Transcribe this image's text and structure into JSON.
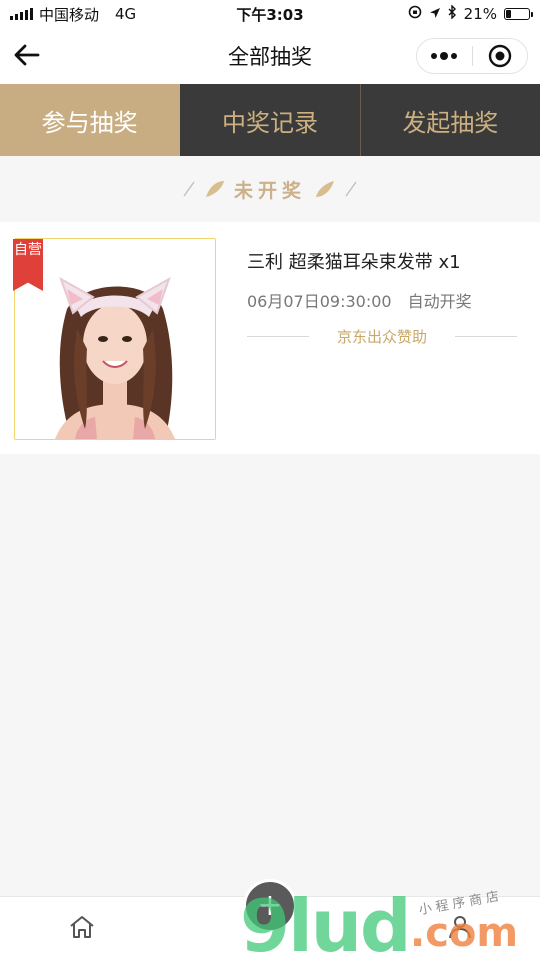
{
  "status_bar": {
    "carrier": "中国移动",
    "network": "4G",
    "time": "下午3:03",
    "battery_percent": "21%",
    "battery_level": 0.21
  },
  "nav": {
    "title": "全部抽奖"
  },
  "tabs": [
    {
      "label": "参与抽奖",
      "active": true
    },
    {
      "label": "中奖记录",
      "active": false
    },
    {
      "label": "发起抽奖",
      "active": false
    }
  ],
  "section": {
    "title": "未开奖"
  },
  "prize": {
    "badge": "自营",
    "name": "三利 超柔猫耳朵束发带 x1",
    "draw_time": "06月07日09:30:00",
    "draw_mode": "自动开奖",
    "sponsor": "京东出众赞助"
  },
  "watermark": {
    "brand": "9lud",
    "domain": ".com",
    "tagline": "小程序商店"
  },
  "colors": {
    "active_tab": "#c9ad82",
    "tab_bar": "#3a3a3a",
    "gold_text": "#cdb080",
    "badge_red": "#e0403a"
  },
  "icons": {
    "back": "arrow-left",
    "more": "dots",
    "close": "target-circle",
    "home": "house",
    "add": "plus",
    "profile": "person"
  }
}
